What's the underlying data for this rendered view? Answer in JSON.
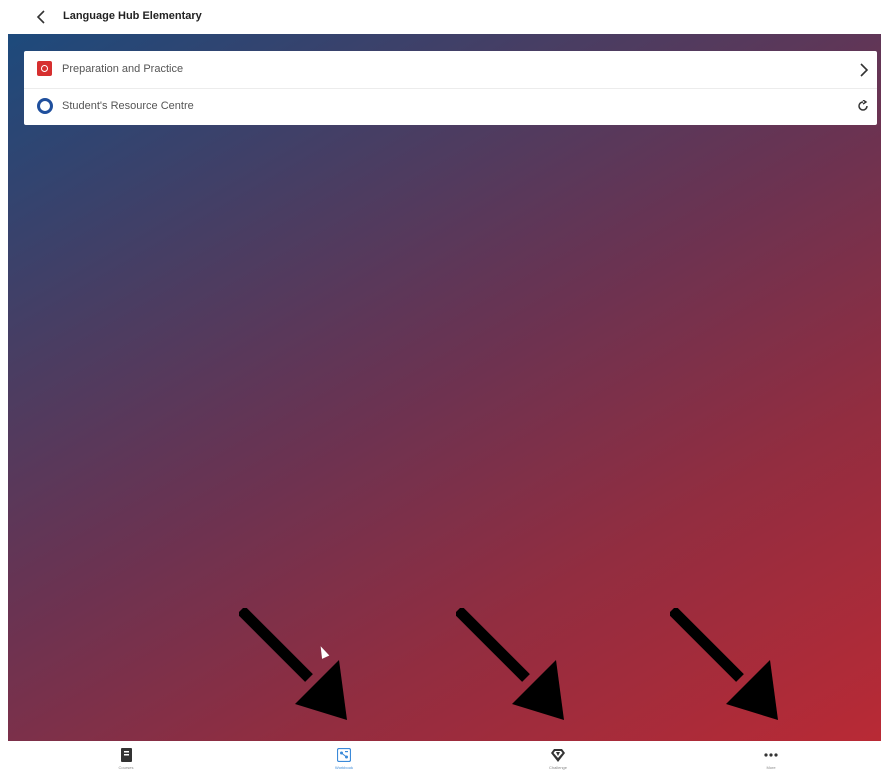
{
  "header": {
    "title": "Language Hub Elementary",
    "back_icon": "chevron-left-icon"
  },
  "menu": {
    "items": [
      {
        "label": "Preparation and Practice",
        "icon": "practice-icon",
        "action_icon": "chevron-right-icon",
        "icon_color": "#d62f2f"
      },
      {
        "label": "Student's Resource Centre",
        "icon": "resource-circle-icon",
        "action_icon": "external-link-icon",
        "icon_color": "#1f4f9d"
      }
    ]
  },
  "background": {
    "gradient_start": "#1d4a7c",
    "gradient_end": "#b92a35"
  },
  "annotations": {
    "arrow_count": 3,
    "arrow_color": "#000000"
  },
  "bottom_nav": {
    "items": [
      {
        "label": "Courses",
        "icon": "book-icon",
        "active": false
      },
      {
        "label": "Workbook",
        "icon": "workbook-icon",
        "active": true
      },
      {
        "label": "Challenge",
        "icon": "diamond-icon",
        "active": false
      },
      {
        "label": "More",
        "icon": "more-dots-icon",
        "active": false
      }
    ],
    "active_color": "#3b8ad9",
    "inactive_color": "#555555"
  }
}
